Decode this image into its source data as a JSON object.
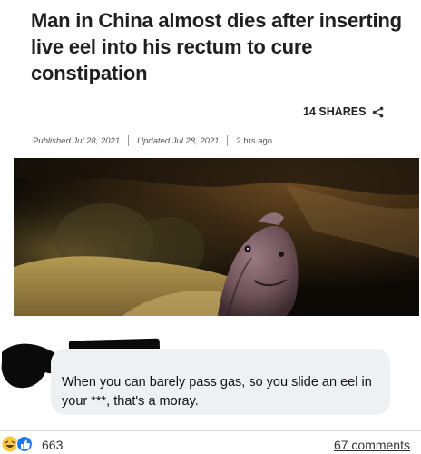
{
  "article": {
    "headline": "Man in China almost dies after inserting live eel into his rectum to cure constipation",
    "shares_label": "14 SHARES",
    "published": "Published Jul 28, 2021",
    "updated": "Updated Jul 28, 2021",
    "ago": "2 hrs ago"
  },
  "comment": {
    "text": "When you can barely pass gas, so you slide an eel in your ***, that's a moray."
  },
  "post_footer": {
    "reaction_count": "663",
    "comments_label": "67 comments"
  },
  "colors": {
    "bubble": "#eef0f3",
    "redaction": "#0a0a0a",
    "like_blue": "#1877f2",
    "haha_yellow": "#f7c844"
  }
}
